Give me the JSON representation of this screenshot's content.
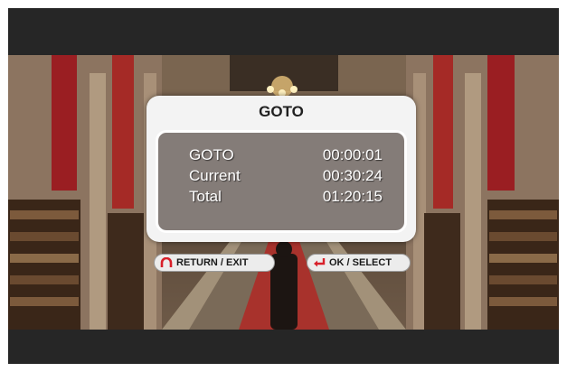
{
  "dialog": {
    "title": "GOTO",
    "rows": [
      {
        "label": "GOTO",
        "value": "00:00:01"
      },
      {
        "label": "Current",
        "value": "00:30:24"
      },
      {
        "label": "Total",
        "value": "01:20:15"
      }
    ]
  },
  "hints": {
    "return_label": "RETURN / EXIT",
    "return_icon": "return-arrow-icon",
    "ok_label": "OK / SELECT",
    "ok_icon": "enter-arrow-icon"
  },
  "colors": {
    "icon_red": "#d8202a",
    "panel_bg": "#f3f3f3",
    "letterbox": "#262626"
  }
}
